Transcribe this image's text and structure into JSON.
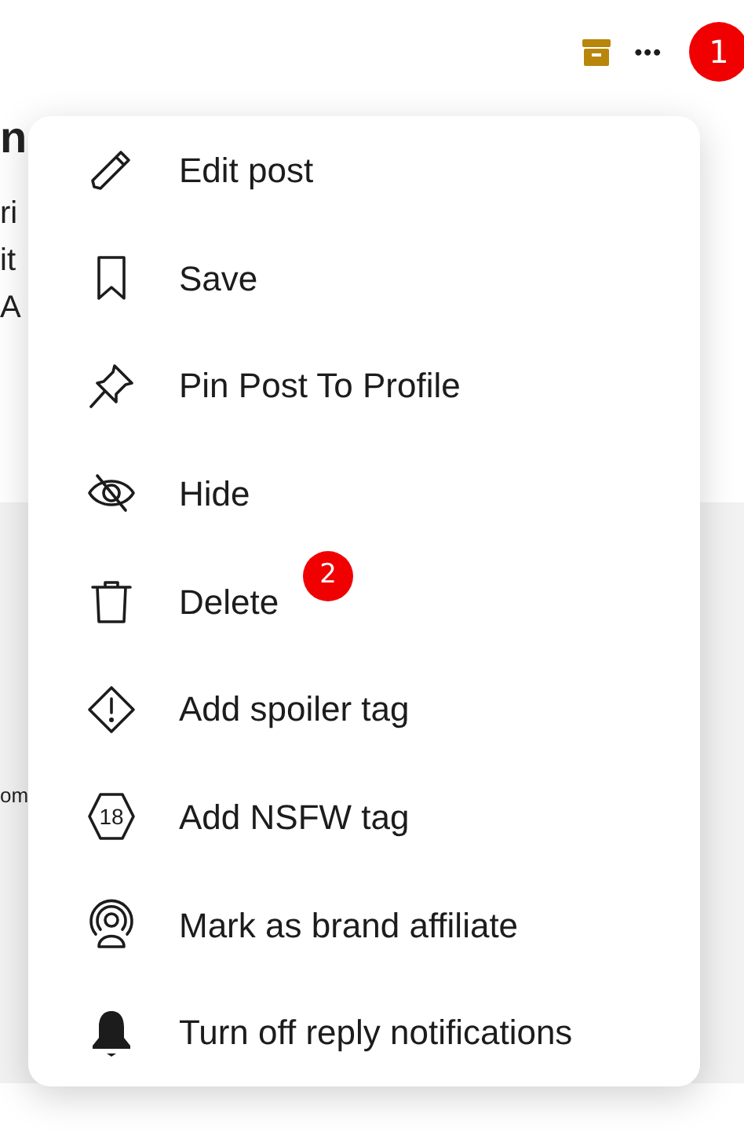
{
  "top_bar": {
    "more_label": "•••",
    "step_badge": "1"
  },
  "background_fragments": [
    "n",
    "ri",
    "it",
    "A",
    "om"
  ],
  "menu": {
    "items": [
      {
        "label": "Edit post"
      },
      {
        "label": "Save"
      },
      {
        "label": "Pin Post To Profile"
      },
      {
        "label": "Hide"
      },
      {
        "label": "Delete",
        "step_badge": "2"
      },
      {
        "label": "Add spoiler tag"
      },
      {
        "label": "Add NSFW tag",
        "icon_text": "18"
      },
      {
        "label": "Mark as brand affiliate"
      },
      {
        "label": "Turn off reply notifications"
      }
    ]
  }
}
